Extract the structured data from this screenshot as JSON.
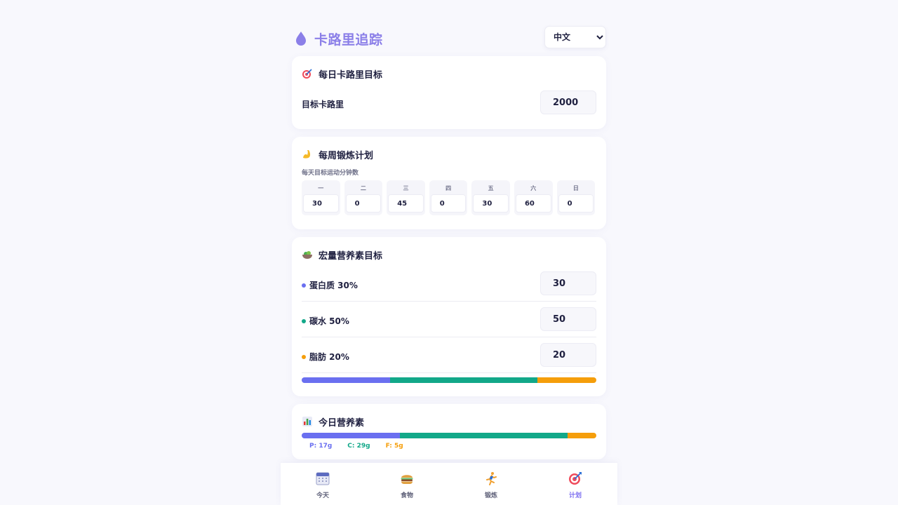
{
  "header": {
    "title": "卡路里追踪",
    "language_selected": "中文"
  },
  "daily_goal": {
    "title": "每日卡路里目标",
    "label": "目标卡路里",
    "value": "2000"
  },
  "weekly_exercise": {
    "title": "每周锻炼计划",
    "subtitle": "每天目标运动分钟数",
    "days": [
      {
        "name": "一",
        "minutes": "30"
      },
      {
        "name": "二",
        "minutes": "0"
      },
      {
        "name": "三",
        "minutes": "45"
      },
      {
        "name": "四",
        "minutes": "0"
      },
      {
        "name": "五",
        "minutes": "30"
      },
      {
        "name": "六",
        "minutes": "60"
      },
      {
        "name": "日",
        "minutes": "0"
      }
    ]
  },
  "macro_goals": {
    "title": "宏量营养素目标",
    "items": [
      {
        "label": "蛋白质 30%",
        "value": "30",
        "percent": 30,
        "color": "#6a6ff0"
      },
      {
        "label": "碳水 50%",
        "value": "50",
        "percent": 50,
        "color": "#12a889"
      },
      {
        "label": "脂肪 20%",
        "value": "20",
        "percent": 20,
        "color": "#f59e0b"
      }
    ]
  },
  "today_nutrients": {
    "title": "今日营养素",
    "items": [
      {
        "label": "P: 17g",
        "grams": 17,
        "color": "#6a6ff0"
      },
      {
        "label": "C: 29g",
        "grams": 29,
        "color": "#12a889"
      },
      {
        "label": "F: 5g",
        "grams": 5,
        "color": "#f59e0b"
      }
    ]
  },
  "nav": {
    "items": [
      {
        "label": "今天",
        "icon": "calendar-icon",
        "active": false
      },
      {
        "label": "食物",
        "icon": "burger-icon",
        "active": false
      },
      {
        "label": "锻炼",
        "icon": "runner-icon",
        "active": false
      },
      {
        "label": "计划",
        "icon": "target-icon",
        "active": true
      }
    ]
  }
}
